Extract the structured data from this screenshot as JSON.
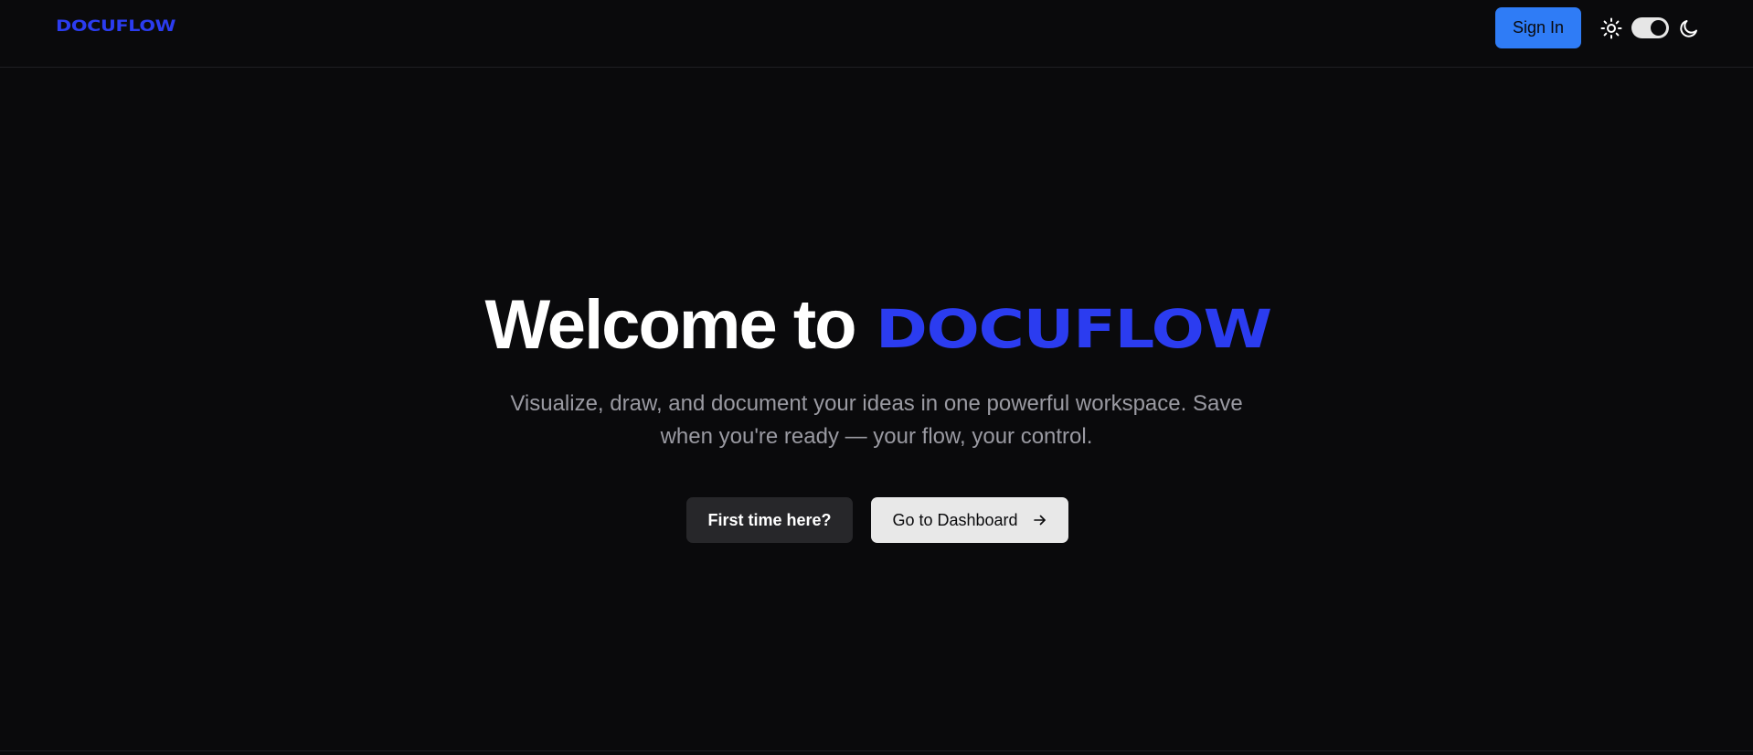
{
  "header": {
    "brand": "DOCUFLOW",
    "sign_in_label": "Sign In",
    "icons": {
      "light_mode": "sun-icon",
      "dark_mode": "moon-icon"
    },
    "theme_toggle_state": "dark"
  },
  "hero": {
    "title_prefix": "Welcome to",
    "title_brand": "DOCUFLOW",
    "subtitle_line1": "Visualize, draw, and document your ideas in one powerful workspace. Save",
    "subtitle_line2": "when you're ready — your flow, your control.",
    "primary_button_label": "First time here?",
    "secondary_button_label": "Go to Dashboard",
    "secondary_button_icon": "arrow-right-icon"
  },
  "colors": {
    "background": "#0a0a0c",
    "brand": "#2b3cf0",
    "accent_button": "#2f7cf6",
    "subtitle_text": "#9a9aa2",
    "dark_button": "#27272a",
    "light_button": "#e8e8e8"
  }
}
